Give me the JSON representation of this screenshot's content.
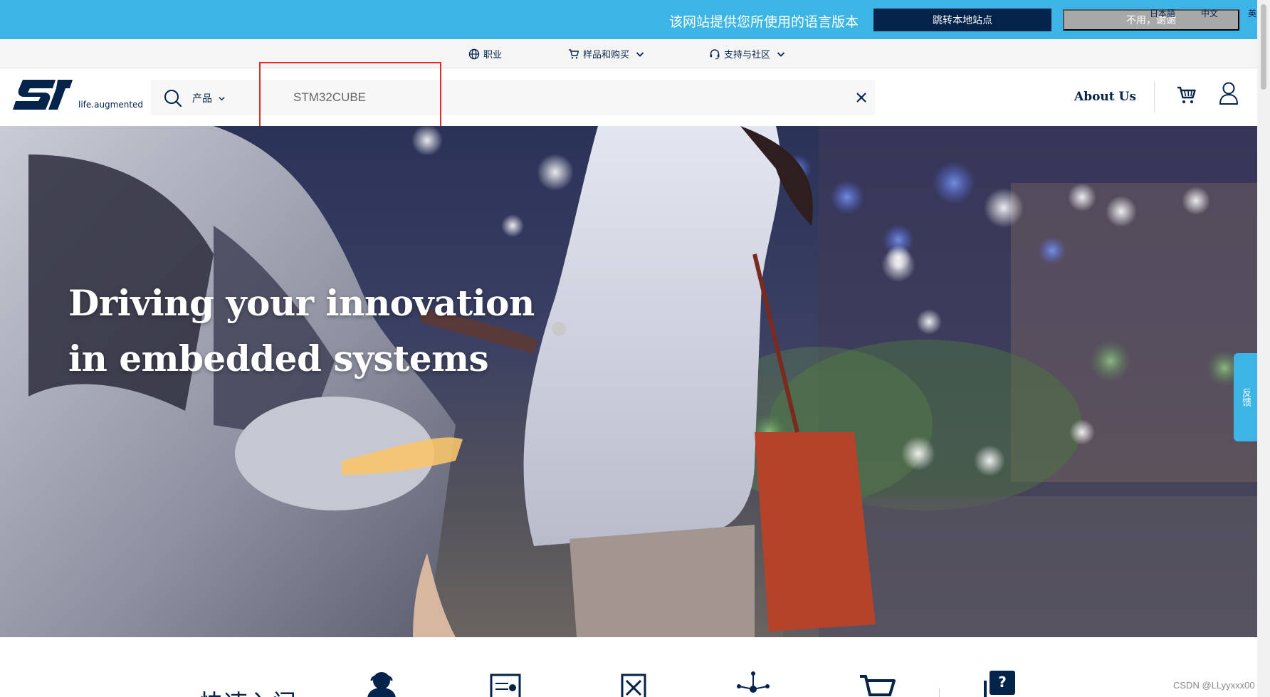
{
  "language_banner": {
    "message": "该网站提供您所使用的语言版本",
    "jump_label": "跳转本地站点",
    "decline_label": "不用，谢谢",
    "languages": [
      "日本語",
      "中文",
      "英语"
    ]
  },
  "utility_nav": {
    "careers": "职业",
    "samples_buy": "样品和购买",
    "support_community": "支持与社区"
  },
  "header": {
    "logo_tagline": "life.augmented",
    "category": "产品",
    "search_value": "STM32CUBE",
    "about_label": "About Us"
  },
  "hero": {
    "title_line1": "Driving your innovation",
    "title_line2": "in embedded systems"
  },
  "feedback_label": "反馈",
  "quick_links": {
    "title": "快速入门",
    "icons": [
      "support-person-icon",
      "dashboard-icon",
      "tools-icon",
      "network-icon",
      "cart-icon",
      "help-icon"
    ]
  },
  "watermark": "CSDN @LLyyxxx00",
  "colors": {
    "banner": "#3cb4e6",
    "navy": "#03234b",
    "highlight": "#e32b2b"
  }
}
